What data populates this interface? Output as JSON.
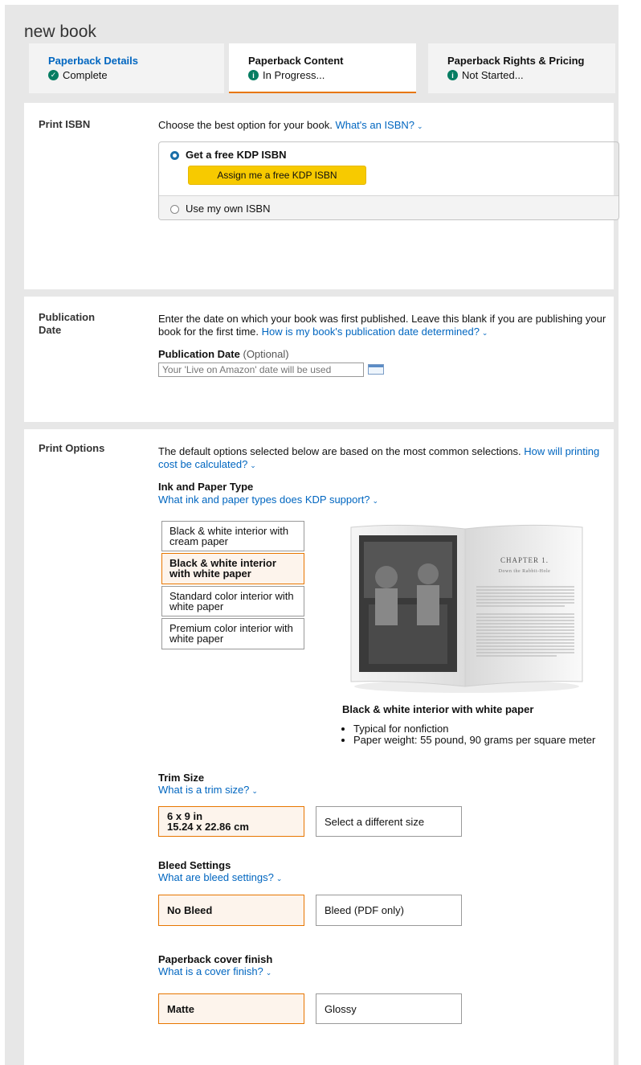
{
  "book_title": "new book",
  "tabs": [
    {
      "title": "Paperback Details",
      "status": "Complete",
      "status_icon": "check-circle-icon"
    },
    {
      "title": "Paperback Content",
      "status": "In Progress...",
      "status_icon": "info-circle-icon"
    },
    {
      "title": "Paperback Rights & Pricing",
      "status": "Not Started...",
      "status_icon": "info-circle-icon"
    }
  ],
  "isbn": {
    "label": "Print ISBN",
    "intro": "Choose the best option for your book.",
    "help_link": "What's an ISBN?",
    "option_free": "Get a free KDP ISBN",
    "assign_button": "Assign me a free KDP ISBN",
    "option_own": "Use my own ISBN",
    "selected": "free"
  },
  "publication": {
    "label": "Publication Date",
    "intro": "Enter the date on which your book was first published. Leave this blank if you are publishing your book for the first time.",
    "help_link": "How is my book's publication date determined?",
    "field_label": "Publication Date",
    "field_optional": "(Optional)",
    "placeholder": "Your 'Live on Amazon' date will be used"
  },
  "print_options": {
    "label": "Print Options",
    "intro": "The default options selected below are based on the most common selections.",
    "help_link": "How will printing cost be calculated?",
    "ink": {
      "heading": "Ink and Paper Type",
      "help_link": "What ink and paper types does KDP support?",
      "options": [
        "Black & white interior with cream paper",
        "Black & white interior with white paper",
        "Standard color interior with white paper",
        "Premium color interior with white paper"
      ],
      "selected_index": 1,
      "preview": {
        "chapter": "CHAPTER 1.",
        "chapter_title": "Down the Rabbit-Hole"
      },
      "caption": "Black & white interior with white paper",
      "bullets": [
        "Typical for nonfiction",
        "Paper weight: 55 pound, 90 grams per square meter"
      ]
    },
    "trim": {
      "heading": "Trim Size",
      "help_link": "What is a trim size?",
      "selected_size": "6 x 9 in",
      "selected_metric": "15.24 x 22.86 cm",
      "other_button": "Select a different size"
    },
    "bleed": {
      "heading": "Bleed Settings",
      "help_link": "What are bleed settings?",
      "options": [
        "No Bleed",
        "Bleed (PDF only)"
      ],
      "selected_index": 0
    },
    "cover": {
      "heading": "Paperback cover finish",
      "help_link": "What is a cover finish?",
      "options": [
        "Matte",
        "Glossy"
      ],
      "selected_index": 0
    }
  },
  "colors": {
    "accent": "#e77600",
    "link": "#0066c0",
    "button_yellow": "#f7ca00",
    "status_green": "#067d62"
  }
}
